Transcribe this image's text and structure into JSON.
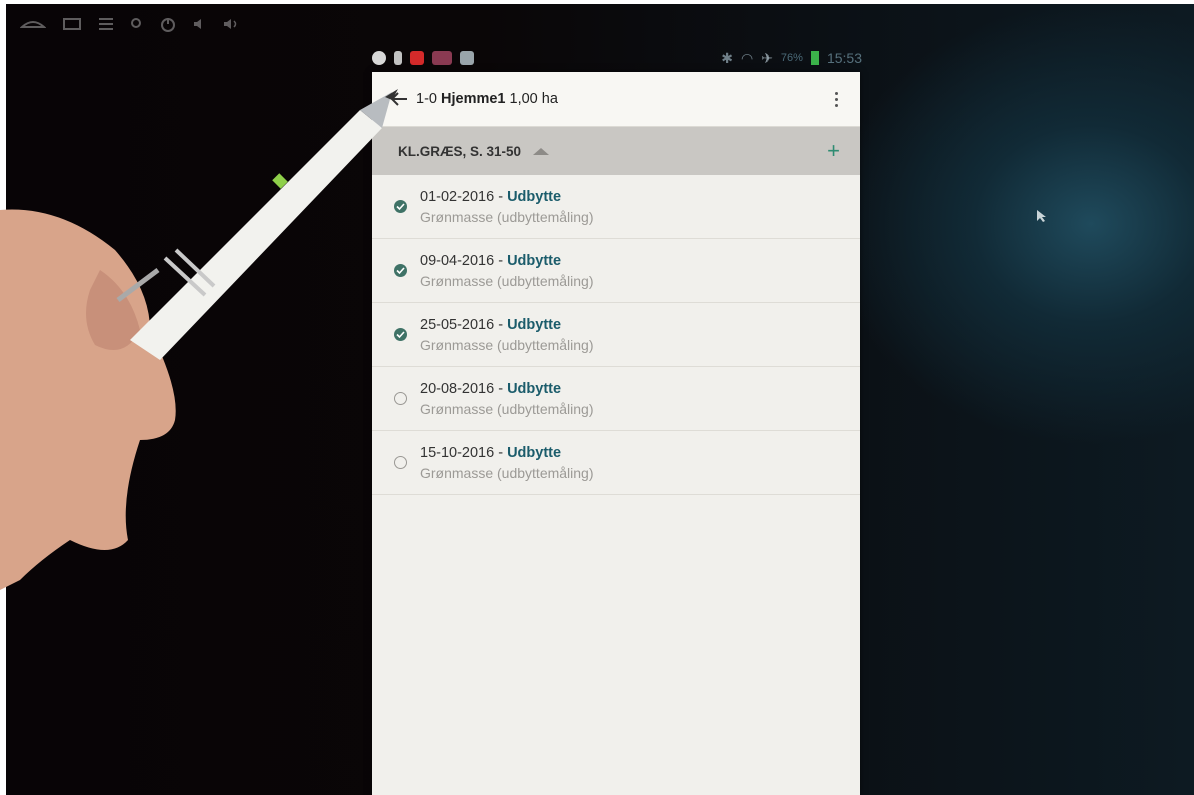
{
  "app_bar": {
    "title_prefix": "1-0",
    "title_name": "Hjemme1",
    "title_area": "1,00 ha"
  },
  "status_bar": {
    "battery": "76%",
    "time": "15:53"
  },
  "section": {
    "label": "KL.GRÆS, S. 31-50",
    "add_label": "+"
  },
  "entries": [
    {
      "date": "01-02-2016",
      "separator": " - ",
      "type": "Udbytte",
      "detail": "Grønmasse (udbyttemåling)",
      "done": true
    },
    {
      "date": "09-04-2016",
      "separator": " - ",
      "type": "Udbytte",
      "detail": "Grønmasse (udbyttemåling)",
      "done": true
    },
    {
      "date": "25-05-2016",
      "separator": " - ",
      "type": "Udbytte",
      "detail": "Grønmasse (udbyttemåling)",
      "done": true
    },
    {
      "date": "20-08-2016",
      "separator": " - ",
      "type": "Udbytte",
      "detail": "Grønmasse (udbyttemåling)",
      "done": false
    },
    {
      "date": "15-10-2016",
      "separator": " - ",
      "type": "Udbytte",
      "detail": "Grønmasse (udbyttemåling)",
      "done": false
    }
  ],
  "icons": {
    "back": "arrow-left-icon",
    "menu": "overflow-menu-icon",
    "add": "plus-icon",
    "collapse": "caret-up-icon",
    "done": "check-circle-icon",
    "open": "empty-circle-icon"
  },
  "colors": {
    "accent": "#2e8c72",
    "type_text": "#1b5c6b",
    "check_fill": "#3f7266"
  }
}
